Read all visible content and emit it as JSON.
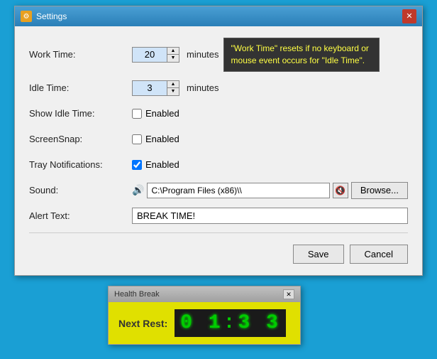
{
  "window": {
    "title": "Settings",
    "icon_label": "gear",
    "close_label": "✕"
  },
  "form": {
    "work_time_label": "Work Time:",
    "work_time_value": "20",
    "work_time_unit": "minutes",
    "idle_time_label": "Idle Time:",
    "idle_time_value": "3",
    "idle_time_unit": "minutes",
    "show_idle_label": "Show Idle Time:",
    "show_idle_enabled_label": "Enabled",
    "show_idle_checked": false,
    "screensnap_label": "ScreenSnap:",
    "screensnap_enabled_label": "Enabled",
    "screensnap_checked": false,
    "tray_notif_label": "Tray Notifications:",
    "tray_notif_enabled_label": "Enabled",
    "tray_notif_checked": true,
    "sound_label": "Sound:",
    "sound_path": "C:\\Program Files (x86)\\",
    "alert_text_label": "Alert Text:",
    "alert_text_value": "BREAK TIME!"
  },
  "tooltip": {
    "text": "\"Work Time\" resets if no keyboard or mouse event occurs for \"Idle Time\"."
  },
  "buttons": {
    "browse_label": "Browse...",
    "save_label": "Save",
    "cancel_label": "Cancel"
  },
  "health_window": {
    "title": "Health Break",
    "close_label": "✕",
    "next_rest_label": "Next Rest:",
    "display": "01:33"
  }
}
